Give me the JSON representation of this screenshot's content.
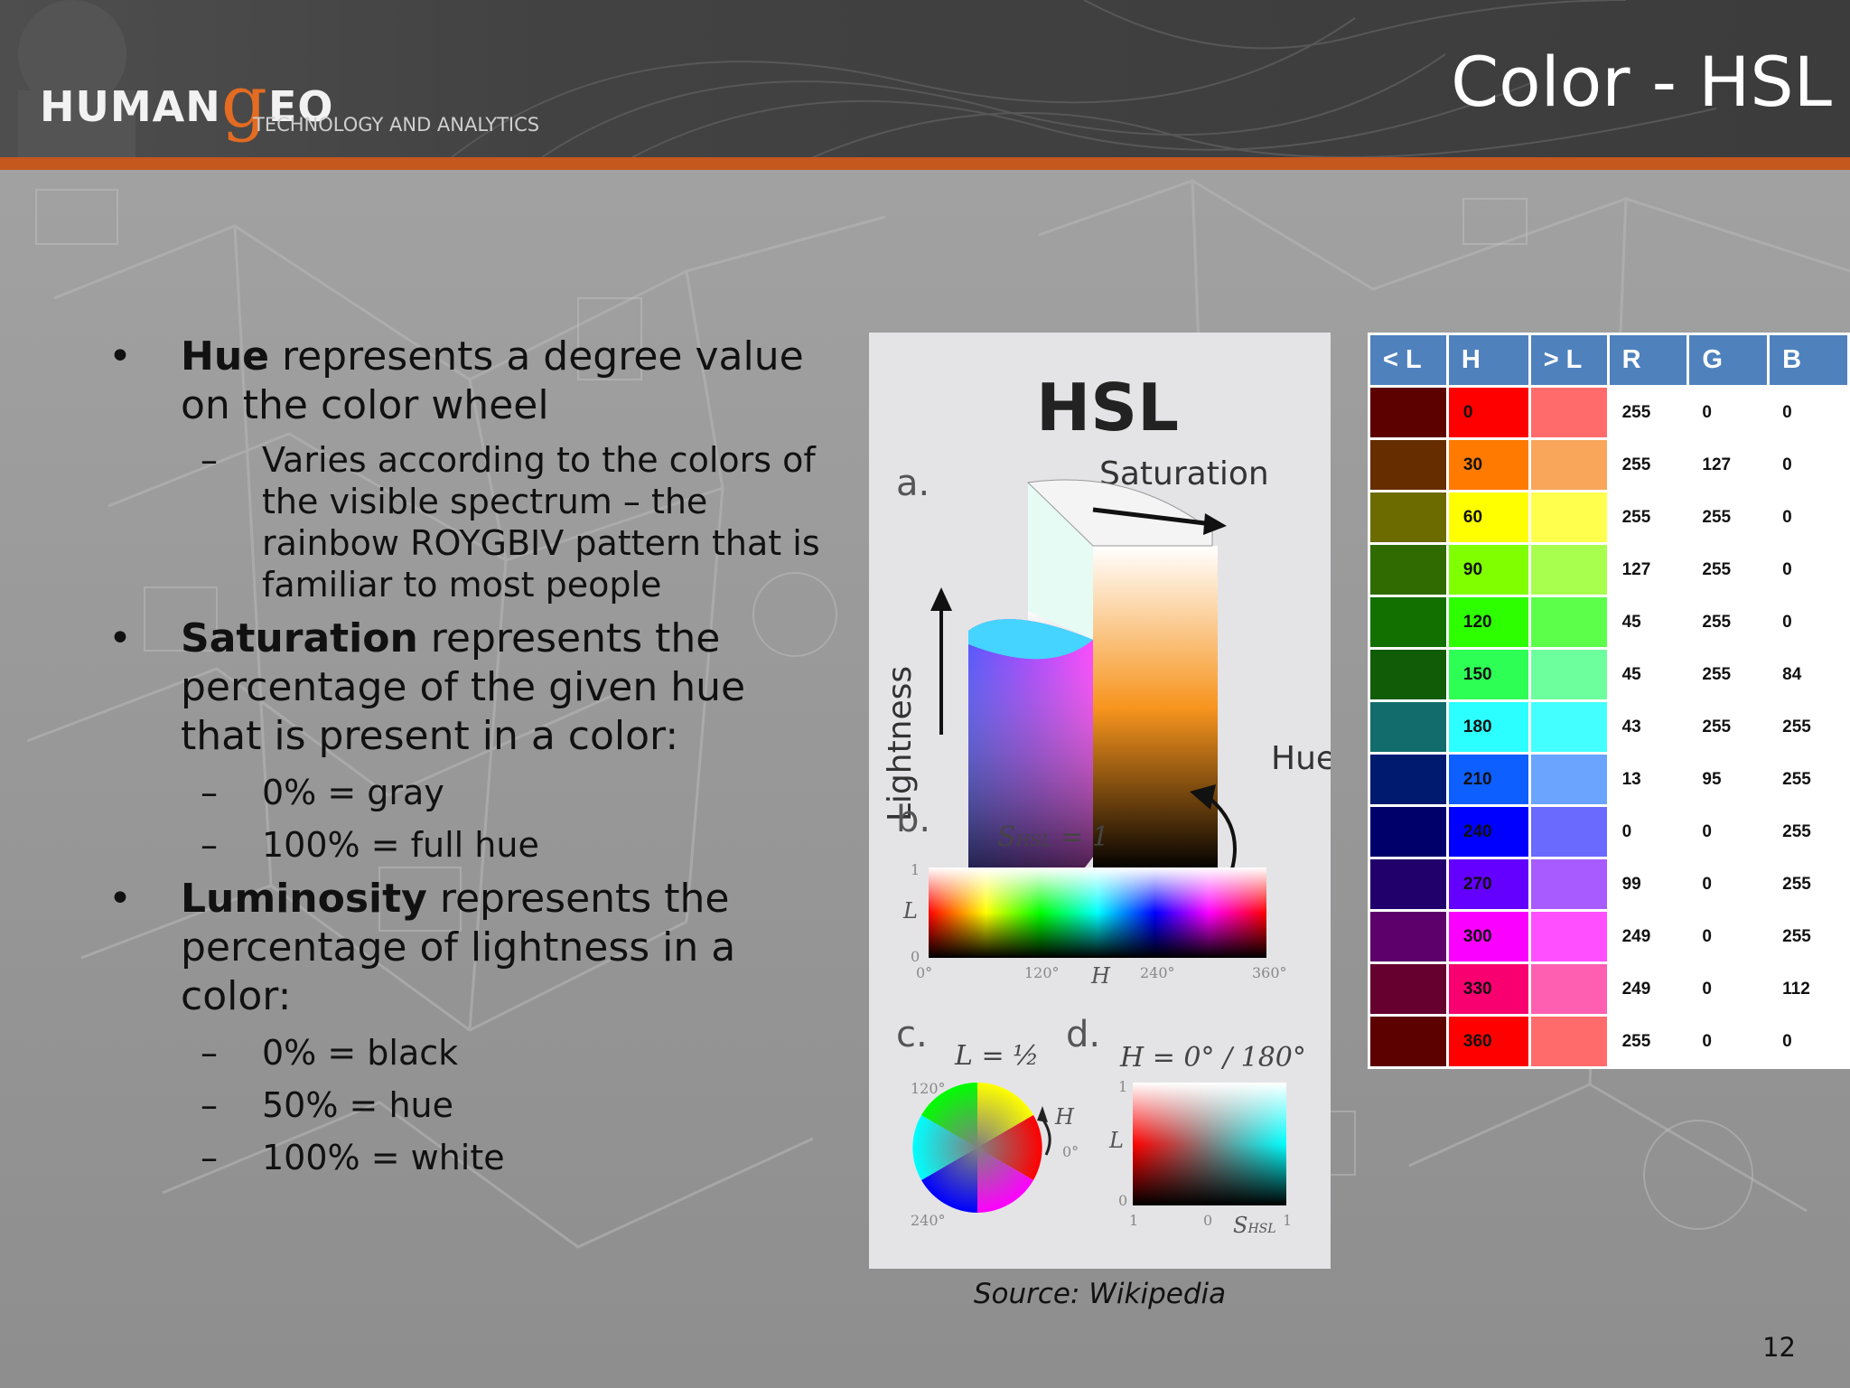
{
  "header": {
    "logo_human": "HUMAN",
    "logo_g": "g",
    "logo_eo": "EO",
    "logo_tagline": "TECHNOLOGY AND ANALYTICS",
    "title": "Color - HSL"
  },
  "bullets": [
    {
      "term": "Hue",
      "text": " represents a degree value on the color wheel",
      "subs": [
        "Varies according to the colors of the visible spectrum – the rainbow ROYGBIV pattern that is familiar to most people"
      ]
    },
    {
      "term": "Saturation",
      "text": " represents the percentage of the given hue that is present in a color:",
      "subs": [
        "0% = gray",
        "100% = full hue"
      ]
    },
    {
      "term": "Luminosity",
      "text": " represents the percentage of lightness in a color:",
      "subs": [
        "0% = black",
        "50% = hue",
        "100% = white"
      ]
    }
  ],
  "figure": {
    "title": "HSL",
    "a_label": "a.",
    "saturation_label": "Saturation",
    "lightness_label": "Lightness",
    "hue_label": "Hue",
    "b_label": "b.",
    "b_s_label": "S",
    "b_s_sub": "HSL",
    "b_s_eq": " = 1",
    "b_l": "L",
    "b_l1": "1",
    "b_l0": "0",
    "b_ticks": [
      "0°",
      "120°",
      "240°",
      "360°"
    ],
    "b_h": "H",
    "c_label": "c.",
    "c_eq": "L = ½",
    "c_120": "120°",
    "c_240": "240°",
    "c_0": "0°",
    "c_h": "H",
    "d_label": "d.",
    "d_eq": "H = 0° / 180°",
    "d_l": "L",
    "d_l1": "1",
    "d_l0": "0",
    "d_s": "S",
    "d_s_sub": "HSL",
    "d_x1": "1",
    "d_x0": "0",
    "d_x1b": "1"
  },
  "source": "Source: Wikipedia",
  "table": {
    "headers": [
      "< L",
      "H",
      "> L",
      "R",
      "G",
      "B"
    ],
    "rows": [
      {
        "h": "0",
        "r": "255",
        "g": "0",
        "b": "0",
        "dark": "#5c0000",
        "hue": "#ff0000",
        "light": "#ff6b6b"
      },
      {
        "h": "30",
        "r": "255",
        "g": "127",
        "b": "0",
        "dark": "#662d00",
        "hue": "#ff7a00",
        "light": "#f9a65a"
      },
      {
        "h": "60",
        "r": "255",
        "g": "255",
        "b": "0",
        "dark": "#6b6b00",
        "hue": "#ffff00",
        "light": "#ffff4d"
      },
      {
        "h": "90",
        "r": "127",
        "g": "255",
        "b": "0",
        "dark": "#2f6b00",
        "hue": "#7fff00",
        "light": "#a9ff4d"
      },
      {
        "h": "120",
        "r": "45",
        "g": "255",
        "b": "0",
        "dark": "#127000",
        "hue": "#2dff00",
        "light": "#5cff4a"
      },
      {
        "h": "150",
        "r": "45",
        "g": "255",
        "b": "84",
        "dark": "#115c06",
        "hue": "#2dff54",
        "light": "#6dff9e"
      },
      {
        "h": "180",
        "r": "43",
        "g": "255",
        "b": "255",
        "dark": "#126c6c",
        "hue": "#2bffff",
        "light": "#43ffff"
      },
      {
        "h": "210",
        "r": "13",
        "g": "95",
        "b": "255",
        "dark": "#001a70",
        "hue": "#0d5fff",
        "light": "#6aa4ff"
      },
      {
        "h": "240",
        "r": "0",
        "g": "0",
        "b": "255",
        "dark": "#00006b",
        "hue": "#0000ff",
        "light": "#6a6aff"
      },
      {
        "h": "270",
        "r": "99",
        "g": "0",
        "b": "255",
        "dark": "#22006b",
        "hue": "#6300ff",
        "light": "#a85bff"
      },
      {
        "h": "300",
        "r": "249",
        "g": "0",
        "b": "255",
        "dark": "#5d006b",
        "hue": "#f900ff",
        "light": "#ff4fff"
      },
      {
        "h": "330",
        "r": "249",
        "g": "0",
        "b": "112",
        "dark": "#65002f",
        "hue": "#f90070",
        "light": "#ff5fb0"
      },
      {
        "h": "360",
        "r": "255",
        "g": "0",
        "b": "0",
        "dark": "#5c0000",
        "hue": "#ff0000",
        "light": "#ff6b6b"
      }
    ]
  },
  "page_number": "12",
  "colors": {
    "accent": "#c4581d",
    "header_bg": "#424242",
    "table_header": "#4f81bd"
  }
}
